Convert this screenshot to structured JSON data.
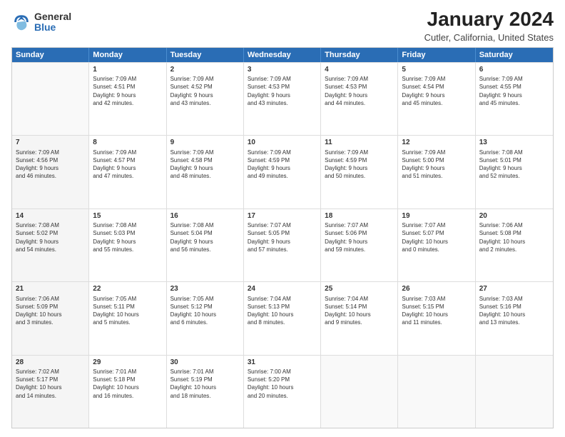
{
  "logo": {
    "general": "General",
    "blue": "Blue"
  },
  "title": "January 2024",
  "subtitle": "Cutler, California, United States",
  "days": [
    "Sunday",
    "Monday",
    "Tuesday",
    "Wednesday",
    "Thursday",
    "Friday",
    "Saturday"
  ],
  "weeks": [
    [
      {
        "num": "",
        "info": "",
        "empty": true
      },
      {
        "num": "1",
        "info": "Sunrise: 7:09 AM\nSunset: 4:51 PM\nDaylight: 9 hours\nand 42 minutes."
      },
      {
        "num": "2",
        "info": "Sunrise: 7:09 AM\nSunset: 4:52 PM\nDaylight: 9 hours\nand 43 minutes."
      },
      {
        "num": "3",
        "info": "Sunrise: 7:09 AM\nSunset: 4:53 PM\nDaylight: 9 hours\nand 43 minutes."
      },
      {
        "num": "4",
        "info": "Sunrise: 7:09 AM\nSunset: 4:53 PM\nDaylight: 9 hours\nand 44 minutes."
      },
      {
        "num": "5",
        "info": "Sunrise: 7:09 AM\nSunset: 4:54 PM\nDaylight: 9 hours\nand 45 minutes."
      },
      {
        "num": "6",
        "info": "Sunrise: 7:09 AM\nSunset: 4:55 PM\nDaylight: 9 hours\nand 45 minutes."
      }
    ],
    [
      {
        "num": "7",
        "info": "Sunrise: 7:09 AM\nSunset: 4:56 PM\nDaylight: 9 hours\nand 46 minutes.",
        "shaded": true
      },
      {
        "num": "8",
        "info": "Sunrise: 7:09 AM\nSunset: 4:57 PM\nDaylight: 9 hours\nand 47 minutes."
      },
      {
        "num": "9",
        "info": "Sunrise: 7:09 AM\nSunset: 4:58 PM\nDaylight: 9 hours\nand 48 minutes."
      },
      {
        "num": "10",
        "info": "Sunrise: 7:09 AM\nSunset: 4:59 PM\nDaylight: 9 hours\nand 49 minutes."
      },
      {
        "num": "11",
        "info": "Sunrise: 7:09 AM\nSunset: 4:59 PM\nDaylight: 9 hours\nand 50 minutes."
      },
      {
        "num": "12",
        "info": "Sunrise: 7:09 AM\nSunset: 5:00 PM\nDaylight: 9 hours\nand 51 minutes."
      },
      {
        "num": "13",
        "info": "Sunrise: 7:08 AM\nSunset: 5:01 PM\nDaylight: 9 hours\nand 52 minutes."
      }
    ],
    [
      {
        "num": "14",
        "info": "Sunrise: 7:08 AM\nSunset: 5:02 PM\nDaylight: 9 hours\nand 54 minutes.",
        "shaded": true
      },
      {
        "num": "15",
        "info": "Sunrise: 7:08 AM\nSunset: 5:03 PM\nDaylight: 9 hours\nand 55 minutes."
      },
      {
        "num": "16",
        "info": "Sunrise: 7:08 AM\nSunset: 5:04 PM\nDaylight: 9 hours\nand 56 minutes."
      },
      {
        "num": "17",
        "info": "Sunrise: 7:07 AM\nSunset: 5:05 PM\nDaylight: 9 hours\nand 57 minutes."
      },
      {
        "num": "18",
        "info": "Sunrise: 7:07 AM\nSunset: 5:06 PM\nDaylight: 9 hours\nand 59 minutes."
      },
      {
        "num": "19",
        "info": "Sunrise: 7:07 AM\nSunset: 5:07 PM\nDaylight: 10 hours\nand 0 minutes."
      },
      {
        "num": "20",
        "info": "Sunrise: 7:06 AM\nSunset: 5:08 PM\nDaylight: 10 hours\nand 2 minutes."
      }
    ],
    [
      {
        "num": "21",
        "info": "Sunrise: 7:06 AM\nSunset: 5:09 PM\nDaylight: 10 hours\nand 3 minutes.",
        "shaded": true
      },
      {
        "num": "22",
        "info": "Sunrise: 7:05 AM\nSunset: 5:11 PM\nDaylight: 10 hours\nand 5 minutes."
      },
      {
        "num": "23",
        "info": "Sunrise: 7:05 AM\nSunset: 5:12 PM\nDaylight: 10 hours\nand 6 minutes."
      },
      {
        "num": "24",
        "info": "Sunrise: 7:04 AM\nSunset: 5:13 PM\nDaylight: 10 hours\nand 8 minutes."
      },
      {
        "num": "25",
        "info": "Sunrise: 7:04 AM\nSunset: 5:14 PM\nDaylight: 10 hours\nand 9 minutes."
      },
      {
        "num": "26",
        "info": "Sunrise: 7:03 AM\nSunset: 5:15 PM\nDaylight: 10 hours\nand 11 minutes."
      },
      {
        "num": "27",
        "info": "Sunrise: 7:03 AM\nSunset: 5:16 PM\nDaylight: 10 hours\nand 13 minutes."
      }
    ],
    [
      {
        "num": "28",
        "info": "Sunrise: 7:02 AM\nSunset: 5:17 PM\nDaylight: 10 hours\nand 14 minutes.",
        "shaded": true
      },
      {
        "num": "29",
        "info": "Sunrise: 7:01 AM\nSunset: 5:18 PM\nDaylight: 10 hours\nand 16 minutes."
      },
      {
        "num": "30",
        "info": "Sunrise: 7:01 AM\nSunset: 5:19 PM\nDaylight: 10 hours\nand 18 minutes."
      },
      {
        "num": "31",
        "info": "Sunrise: 7:00 AM\nSunset: 5:20 PM\nDaylight: 10 hours\nand 20 minutes."
      },
      {
        "num": "",
        "info": "",
        "empty": true
      },
      {
        "num": "",
        "info": "",
        "empty": true
      },
      {
        "num": "",
        "info": "",
        "empty": true
      }
    ]
  ]
}
